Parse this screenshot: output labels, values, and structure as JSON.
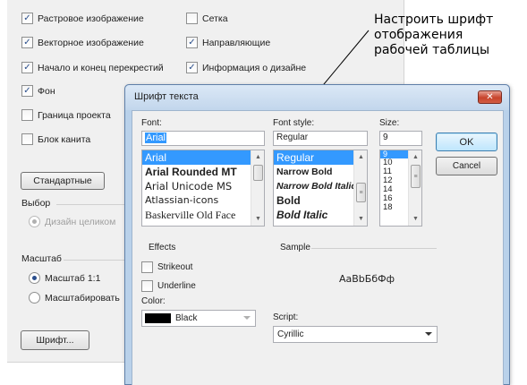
{
  "background_panel": {
    "checkboxes": [
      {
        "label": "Растровое изображение",
        "checked": true
      },
      {
        "label": "Сетка",
        "checked": false
      },
      {
        "label": "Векторное изображение",
        "checked": true
      },
      {
        "label": "Направляющие",
        "checked": true
      },
      {
        "label": "Начало и конец перекрестий",
        "checked": true
      },
      {
        "label": "Информация о дизайне",
        "checked": true
      },
      {
        "label": "Фон",
        "checked": true
      },
      {
        "label": "Граница проекта",
        "checked": false
      },
      {
        "label": "Блок канита",
        "checked": false
      }
    ],
    "standard_button": "Стандартные",
    "choice_group": {
      "label": "Выбор",
      "option": "Дизайн целиком"
    },
    "scale_group": {
      "label": "Масштаб",
      "option_1": "Масштаб 1:1",
      "option_2": "Масштабировать"
    },
    "font_button": "Шрифт..."
  },
  "annotation": {
    "line1": "Настроить шрифт",
    "line2": "отображения",
    "line3": "рабочей таблицы"
  },
  "font_dialog": {
    "title": "Шрифт текста",
    "close_label": "✕",
    "font_label": "Font:",
    "font_value": "Arial",
    "fonts": [
      "Arial",
      "Arial Rounded MT",
      "Arial Unicode MS",
      "Atlassian-icons",
      "Baskerville Old Face"
    ],
    "style_label": "Font style:",
    "style_value": "Regular",
    "styles": [
      "Regular",
      "Narrow Bold",
      "Narrow Bold Italic",
      "Bold",
      "Bold Italic"
    ],
    "size_label": "Size:",
    "size_value": "9",
    "sizes": [
      "9",
      "10",
      "11",
      "12",
      "14",
      "16",
      "18"
    ],
    "ok_label": "OK",
    "cancel_label": "Cancel",
    "effects_label": "Effects",
    "strikeout_label": "Strikeout",
    "underline_label": "Underline",
    "color_label": "Color:",
    "color_value": "Black",
    "sample_label": "Sample",
    "sample_text": "AaBbБбФф",
    "script_label": "Script:",
    "script_value": "Cyrillic"
  }
}
